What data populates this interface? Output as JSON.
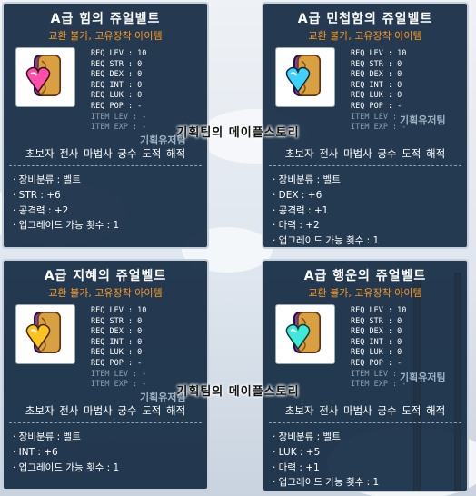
{
  "watermark": "기획팀의 메이플스토리",
  "watermark_small": "기획유저팀",
  "cards": [
    {
      "title": "A급 힘의 쥬얼벨트",
      "restriction": "교환 불가, 고유장착 아이템",
      "stats": [
        "REQ LEV : 10",
        "REQ STR : 0",
        "REQ DEX : 0",
        "REQ INT : 0",
        "REQ LUK : 0",
        "REQ POP : -"
      ],
      "stats_dim": [
        "ITEM LEV : -",
        "ITEM EXP : -"
      ],
      "jobs": "초보자 전사 마법사 궁수 도적 해적",
      "desc": [
        "· 장비분류 : 벨트",
        "· STR : +6",
        "· 공격력 : +2",
        "· 업그레이드 가능 횟수 : 1"
      ],
      "gem_color": "#ff4fa8"
    },
    {
      "title": "A급 민첩함의 쥬얼벨트",
      "restriction": "교환 불가, 고유장착 아이템",
      "stats": [
        "REQ LEV : 10",
        "REQ STR : 0",
        "REQ DEX : 0",
        "REQ INT : 0",
        "REQ LUK : 0",
        "REQ POP : -"
      ],
      "stats_dim": [
        "ITEM LEV : -",
        "ITEM EXP : -"
      ],
      "jobs": "초보자 전사 마법사 궁수 도적 해적",
      "desc": [
        "· 장비분류 : 벨트",
        "· DEX : +6",
        "· 공격력 : +1",
        "· 마력 : +2",
        "· 업그레이드 가능 횟수 : 1"
      ],
      "gem_color": "#3fd0ff"
    },
    {
      "title": "A급 지혜의 쥬얼벨트",
      "restriction": "교환 불가, 고유장착 아이템",
      "stats": [
        "REQ LEV : 10",
        "REQ STR : 0",
        "REQ DEX : 0",
        "REQ INT : 0",
        "REQ LUK : 0",
        "REQ POP : -"
      ],
      "stats_dim": [
        "ITEM LEV : -",
        "ITEM EXP : -"
      ],
      "jobs": "초보자 전사 마법사 궁수 도적 해적",
      "desc": [
        "· 장비분류 : 벨트",
        "· INT : +6",
        "· 업그레이드 가능 횟수 : 1"
      ],
      "gem_color": "#ffc21f"
    },
    {
      "title": "A급 행운의 쥬얼벨트",
      "restriction": "교환 불가, 고유장착 아이템",
      "stats": [
        "REQ LEV : 10",
        "REQ STR : 0",
        "REQ DEX : 0",
        "REQ INT : 0",
        "REQ LUK : 0",
        "REQ POP : -"
      ],
      "stats_dim": [
        "ITEM LEV : -",
        "ITEM EXP : -"
      ],
      "jobs": "초보자 전사 마법사 궁수 도적 해적",
      "desc": [
        "· 장비분류 : 벨트",
        "· LUK : +5",
        "· 마력 : +1",
        "· 업그레이드 가능 횟수 : 1"
      ],
      "gem_color": "#3fe8d8"
    }
  ]
}
